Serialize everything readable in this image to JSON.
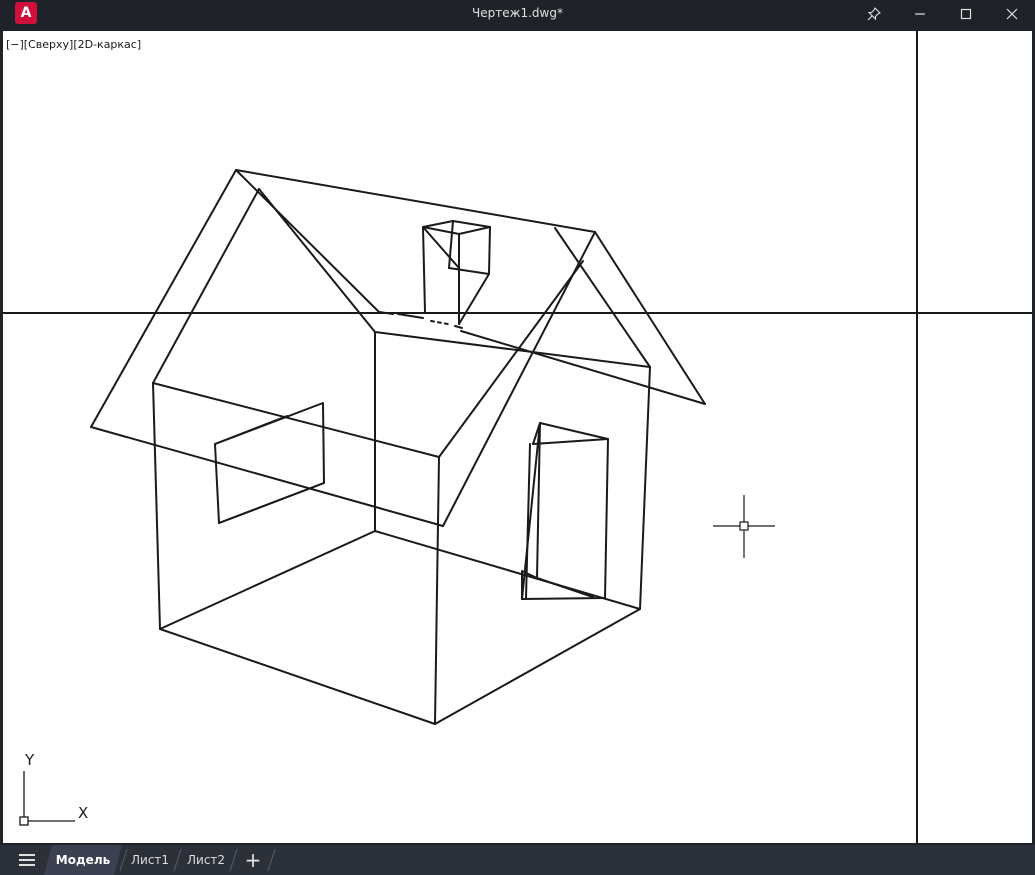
{
  "window": {
    "app_logo": "A",
    "title": "Чертеж1.dwg*"
  },
  "viewport": {
    "label": "[−][Сверху][2D-каркас]",
    "ucs": {
      "y_label": "Y",
      "x_label": "X"
    }
  },
  "layout_tabs": {
    "tabs": [
      {
        "label": "Модель",
        "active": true
      },
      {
        "label": "Лист1",
        "active": false
      },
      {
        "label": "Лист2",
        "active": false
      }
    ],
    "add_label": "+"
  },
  "icons": {
    "menu": "hamburger-icon",
    "pin": "pin-icon",
    "minimize": "minimize-icon",
    "maximize": "maximize-icon",
    "close": "close-icon",
    "add": "plus-icon",
    "ucs": "ucs-icon",
    "crosshair": "crosshair-cursor-icon"
  },
  "colors": {
    "brand": "#d0103a",
    "frame": "#1f2228",
    "canvas": "#ffffff",
    "lines": "#1a1a1a"
  }
}
